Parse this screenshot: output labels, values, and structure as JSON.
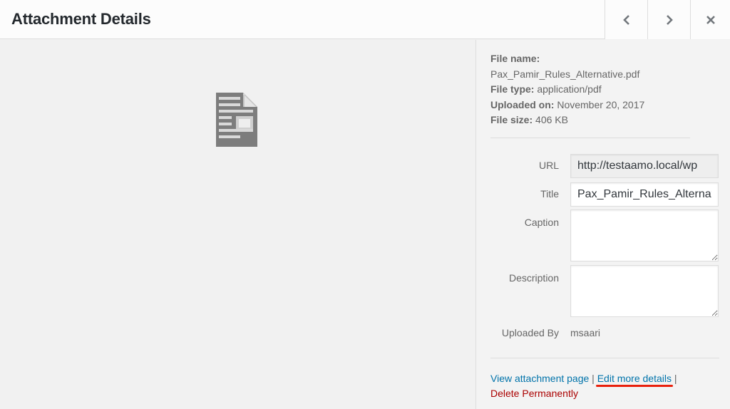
{
  "header": {
    "title": "Attachment Details",
    "prev_label": "Previous",
    "next_label": "Next",
    "close_label": "Close"
  },
  "file_info": {
    "file_name_label": "File name:",
    "file_name": "Pax_Pamir_Rules_Alternative.pdf",
    "file_type_label": "File type:",
    "file_type": "application/pdf",
    "uploaded_on_label": "Uploaded on:",
    "uploaded_on": "November 20, 2017",
    "file_size_label": "File size:",
    "file_size": "406 KB"
  },
  "fields": {
    "url": {
      "label": "URL",
      "value": "http://testaamo.local/wp"
    },
    "title": {
      "label": "Title",
      "value": "Pax_Pamir_Rules_Alternative"
    },
    "caption": {
      "label": "Caption",
      "value": ""
    },
    "description": {
      "label": "Description",
      "value": ""
    },
    "uploaded_by": {
      "label": "Uploaded By",
      "value": "msaari"
    }
  },
  "actions": {
    "view_attachment": "View attachment page",
    "separator": "|",
    "edit_more": "Edit more details",
    "delete": "Delete Permanently"
  },
  "colors": {
    "link": "#0073aa",
    "delete": "#aa0000",
    "highlight_underline": "#e8200c"
  }
}
